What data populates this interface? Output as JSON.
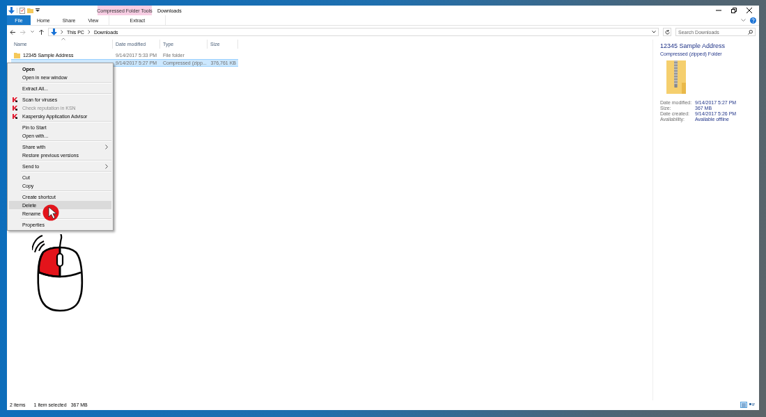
{
  "window": {
    "title": "Downloads",
    "contextual_group": "Compressed Folder Tools"
  },
  "ribbon_tabs": [
    {
      "label": "File",
      "kind": "file"
    },
    {
      "label": "Home",
      "kind": "tab"
    },
    {
      "label": "Share",
      "kind": "tab"
    },
    {
      "label": "View",
      "kind": "tab"
    },
    {
      "label": "Extract",
      "kind": "contextual"
    }
  ],
  "address_bar": {
    "path": [
      "This PC",
      "Downloads"
    ]
  },
  "search": {
    "placeholder": "Search Downloads"
  },
  "columns": [
    "Name",
    "Date modified",
    "Type",
    "Size"
  ],
  "rows": [
    {
      "name": "12345 Sample Address",
      "date_modified": "9/14/2017 5:33 PM",
      "type": "File folder",
      "selected": false
    },
    {
      "date_modified": "9/14/2017 5:27 PM",
      "type": "Compressed (zipp...",
      "size": "376,761 KB",
      "selected": true
    }
  ],
  "context_menu": {
    "groups": [
      {
        "items": [
          {
            "label": "Open",
            "kind": "plain",
            "default": true,
            "disabled": false,
            "submenu": false,
            "selected": false
          },
          {
            "label": "Open in new window",
            "kind": "plain",
            "default": false,
            "disabled": false,
            "submenu": false,
            "selected": false
          }
        ]
      },
      {
        "items": [
          {
            "label": "Extract All...",
            "kind": "plain",
            "default": false,
            "disabled": false,
            "submenu": false,
            "selected": false
          }
        ]
      },
      {
        "items": [
          {
            "label": "Scan for viruses",
            "kind": "kaspersky",
            "default": false,
            "disabled": false,
            "submenu": false,
            "selected": false
          },
          {
            "label": "Check reputation in KSN",
            "kind": "kaspersky",
            "default": false,
            "disabled": true,
            "submenu": false,
            "selected": false
          },
          {
            "label": "Kaspersky Application Advisor",
            "kind": "kaspersky",
            "default": false,
            "disabled": false,
            "submenu": false,
            "selected": false
          }
        ]
      },
      {
        "items": [
          {
            "label": "Pin to Start",
            "kind": "plain",
            "default": false,
            "disabled": false,
            "submenu": false,
            "selected": false
          },
          {
            "label": "Open with...",
            "kind": "plain",
            "default": false,
            "disabled": false,
            "submenu": false,
            "selected": false
          }
        ]
      },
      {
        "items": [
          {
            "label": "Share with",
            "kind": "plain",
            "default": false,
            "disabled": false,
            "submenu": true,
            "selected": false
          },
          {
            "label": "Restore previous versions",
            "kind": "plain",
            "default": false,
            "disabled": false,
            "submenu": false,
            "selected": false
          }
        ]
      },
      {
        "items": [
          {
            "label": "Send to",
            "kind": "plain",
            "default": false,
            "disabled": false,
            "submenu": true,
            "selected": false
          }
        ]
      },
      {
        "items": [
          {
            "label": "Cut",
            "kind": "plain",
            "default": false,
            "disabled": false,
            "submenu": false,
            "selected": false
          },
          {
            "label": "Copy",
            "kind": "plain",
            "default": false,
            "disabled": false,
            "submenu": false,
            "selected": false
          }
        ]
      },
      {
        "items": [
          {
            "label": "Create shortcut",
            "kind": "plain",
            "default": false,
            "disabled": false,
            "submenu": false,
            "selected": false
          },
          {
            "label": "Delete",
            "kind": "plain",
            "default": false,
            "disabled": false,
            "submenu": false,
            "selected": true
          },
          {
            "label": "Rename",
            "kind": "plain",
            "default": false,
            "disabled": false,
            "submenu": false,
            "selected": false
          }
        ]
      },
      {
        "items": [
          {
            "label": "Properties",
            "kind": "plain",
            "default": false,
            "disabled": false,
            "submenu": false,
            "selected": false
          }
        ]
      }
    ]
  },
  "details": {
    "title": "12345 Sample Address",
    "subtitle": "Compressed (zipped) Folder",
    "properties": [
      {
        "label": "Date modified:",
        "value": "9/14/2017 5:27 PM"
      },
      {
        "label": "Size:",
        "value": "367 MB"
      },
      {
        "label": "Date created:",
        "value": "9/14/2017 5:26 PM"
      },
      {
        "label": "Availability:",
        "value": "Available offline"
      }
    ]
  },
  "status_bar": {
    "item_count": "2 items",
    "selection": "1 item selected",
    "selection_size": "367 MB"
  }
}
